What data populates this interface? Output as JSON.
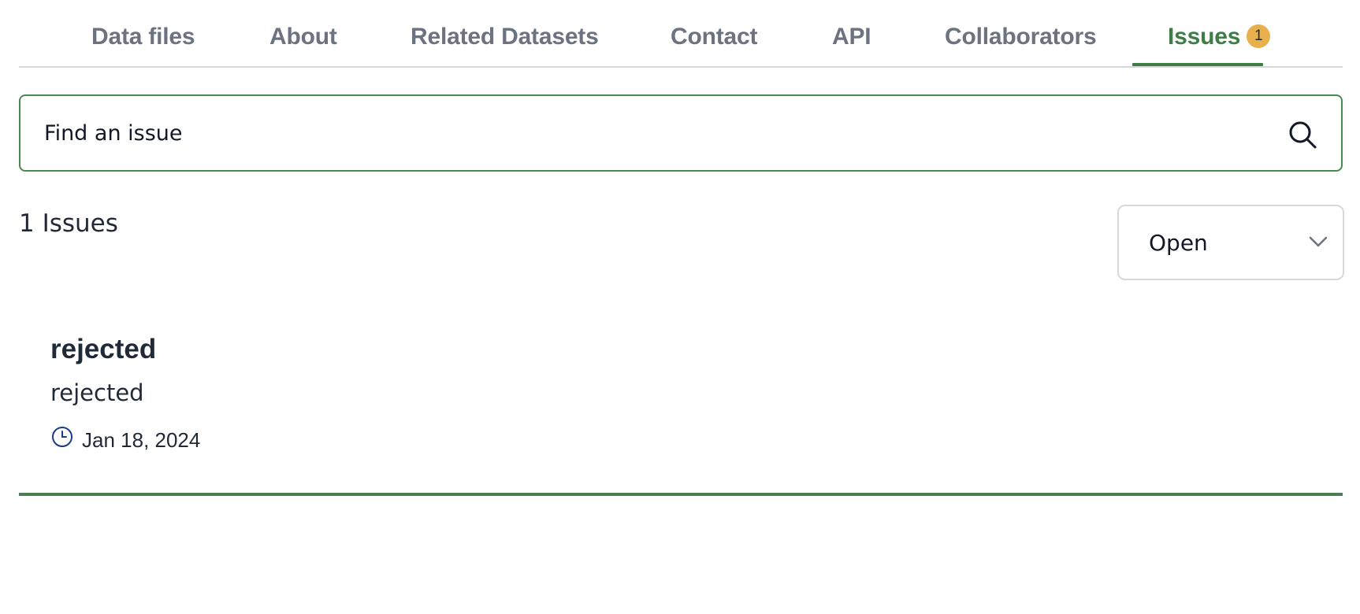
{
  "tabs": [
    {
      "label": "Data files"
    },
    {
      "label": "About"
    },
    {
      "label": "Related Datasets"
    },
    {
      "label": "Contact"
    },
    {
      "label": "API"
    },
    {
      "label": "Collaborators"
    },
    {
      "label": "Issues",
      "badge": "1",
      "active": true
    }
  ],
  "search": {
    "placeholder": "Find an issue",
    "icon": "search-icon"
  },
  "summary": {
    "count_label": "1 Issues"
  },
  "status_filter": {
    "selected": "Open",
    "icon": "chevron-down-icon"
  },
  "issues": [
    {
      "title": "rejected",
      "description": "rejected",
      "date": "Jan 18, 2024",
      "icon": "clock-icon"
    }
  ],
  "colors": {
    "accent": "#3f7d47",
    "badge": "#e8b04b",
    "tab_inactive": "#6b7280",
    "clock_icon": "#1e3a8a"
  }
}
